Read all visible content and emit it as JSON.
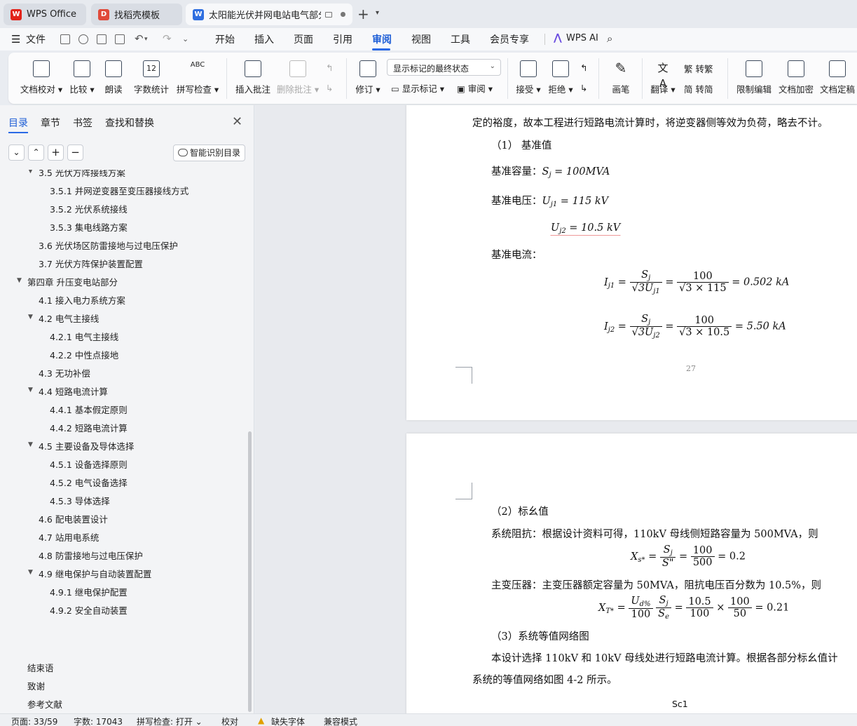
{
  "colors": {
    "accent": "#2b6ae6",
    "wps_red": "#e2231a",
    "docer_red": "#e04a3a",
    "writer_blue": "#2f6fe0"
  },
  "tabs": [
    {
      "label": "WPS Office",
      "icon": "wps-logo-icon"
    },
    {
      "label": "找稻壳模板",
      "icon": "docer-icon"
    },
    {
      "label": "太阳能光伏并网电站电气部分设",
      "icon": "writer-doc-icon"
    }
  ],
  "menu": {
    "file": "文件",
    "items": [
      "开始",
      "插入",
      "页面",
      "引用",
      "审阅",
      "视图",
      "工具",
      "会员专享"
    ],
    "active": "审阅",
    "ai": "WPS AI"
  },
  "ribbon": {
    "doc_check": "文档校对",
    "compare": "比较",
    "read_aloud": "朗读",
    "word_count": "字数统计",
    "spell_check": "拼写检查",
    "insert_comment": "插入批注",
    "delete_comment": "删除批注",
    "revise": "修订",
    "markup_select": "显示标记的最终状态",
    "show_markup": "显示标记",
    "review": "审阅",
    "accept": "接受",
    "reject": "拒绝",
    "pen": "画笔",
    "translate": "翻译",
    "to_traditional": "转繁",
    "to_simplified": "转简",
    "restrict_edit": "限制编辑",
    "encrypt": "文档加密",
    "finalize": "文档定稿"
  },
  "left_panel": {
    "tabs": [
      "目录",
      "章节",
      "书签",
      "查找和替换"
    ],
    "smart_btn": "智能识别目录",
    "toc": [
      {
        "label": "3.5  光伏方阵接线方案",
        "level": 2,
        "collapsible": true
      },
      {
        "label": "3.5.1  并网逆变器至变压器接线方式",
        "level": 3
      },
      {
        "label": "3.5.2  光伏系统接线",
        "level": 3
      },
      {
        "label": "3.5.3  集电线路方案",
        "level": 3
      },
      {
        "label": "3.6  光伏场区防雷接地与过电压保护",
        "level": 2
      },
      {
        "label": "3.7  光伏方阵保护装置配置",
        "level": 2
      },
      {
        "label": "第四章  升压变电站部分",
        "level": 1,
        "collapsible": true
      },
      {
        "label": "4.1  接入电力系统方案",
        "level": 2
      },
      {
        "label": "4.2  电气主接线",
        "level": 2,
        "collapsible": true
      },
      {
        "label": "4.2.1  电气主接线",
        "level": 3
      },
      {
        "label": "4.2.2  中性点接地",
        "level": 3
      },
      {
        "label": "4.3  无功补偿",
        "level": 2
      },
      {
        "label": "4.4  短路电流计算",
        "level": 2,
        "collapsible": true
      },
      {
        "label": "4.4.1 基本假定原则",
        "level": 3
      },
      {
        "label": "4.4.2  短路电流计算",
        "level": 3
      },
      {
        "label": "4.5  主要设备及导体选择",
        "level": 2,
        "collapsible": true
      },
      {
        "label": "4.5.1  设备选择原则",
        "level": 3
      },
      {
        "label": "4.5.2  电气设备选择",
        "level": 3
      },
      {
        "label": "4.5.3  导体选择",
        "level": 3
      },
      {
        "label": "4.6  配电装置设计",
        "level": 2
      },
      {
        "label": "4.7  站用电系统",
        "level": 2
      },
      {
        "label": "4.8  防雷接地与过电压保护",
        "level": 2
      },
      {
        "label": "4.9  继电保护与自动装置配置",
        "level": 2,
        "collapsible": true
      },
      {
        "label": "4.9.1  继电保护配置",
        "level": 3
      },
      {
        "label": "4.9.2  安全自动装置",
        "level": 3
      }
    ],
    "footer": [
      "结束语",
      "致谢",
      "参考文献"
    ]
  },
  "doc": {
    "p1_line0": "定的裕度，故本工程进行短路电流计算时，将逆变器侧等效为负荷，略去不计。",
    "p1_h1": "（1） 基准值",
    "p1_sj_label": "基准容量：",
    "p1_sj": "S",
    "p1_sj_sub": "j",
    "p1_sj_val": " = 100MVA",
    "p1_uj_label": "基准电压：",
    "p1_uj1": "U",
    "p1_uj1_sub": "j1",
    "p1_uj1_val": " = 115 kV",
    "p1_uj2": "U",
    "p1_uj2_sub": "j2",
    "p1_uj2_val": " = 10.5 kV",
    "p1_ij_label": "基准电流：",
    "eq1_lhs": "I",
    "eq1_lhs_sub": "j1",
    "eq1_f1_n": "S",
    "eq1_f1_n_sub": "j",
    "eq1_f1_d": "√3U",
    "eq1_f1_d_sub": "j1",
    "eq1_f2_n": "100",
    "eq1_f2_d": "√3 × 115",
    "eq1_res": "= 0.502 kA",
    "eq2_lhs": "I",
    "eq2_lhs_sub": "j2",
    "eq2_f1_n": "S",
    "eq2_f1_n_sub": "j",
    "eq2_f1_d": "√3U",
    "eq2_f1_d_sub": "j2",
    "eq2_f2_n": "100",
    "eq2_f2_d": "√3 × 10.5",
    "eq2_res": "= 5.50 kA",
    "page_num": "27",
    "p2_h2": "（2）标幺值",
    "p2_sys": "系统阻抗：根据设计资料可得，110kV 母线侧短路容量为 500MVA，则",
    "eq3_lhs": "X",
    "eq3_lhs_sub": "s*",
    "eq3_f1_n": "S",
    "eq3_f1_n_sub": "j",
    "eq3_f1_d": "S\"",
    "eq3_f2_n": "100",
    "eq3_f2_d": "500",
    "eq3_res": "= 0.2",
    "p2_tr": "主变压器：主变压器额定容量为 50MVA，阻抗电压百分数为 10.5%，则",
    "eq4_lhs": "X",
    "eq4_lhs_sub": "T*",
    "eq4_f1_n": "U",
    "eq4_f1_n_sub": "d%",
    "eq4_f1_d": "100",
    "eq4_f2_n": "S",
    "eq4_f2_n_sub": "j",
    "eq4_f2_d": "S",
    "eq4_f2_d_sub": "e",
    "eq4_f3_n": "10.5",
    "eq4_f3_d": "100",
    "eq4_f4_n": "100",
    "eq4_f4_d": "50",
    "eq4_res": "= 0.21",
    "p2_h3": "（3）系统等值网络图",
    "p2_para1": "本设计选择 110kV 和 10kV 母线处进行短路电流计算。根据各部分标幺值计",
    "p2_para2": "系统的等值网络如图 4-2 所示。",
    "p2_fig_label": "Sc1"
  },
  "status": {
    "page": "页面: 33/59",
    "words": "字数: 17043",
    "spell": "拼写检查: 打开",
    "proof": "校对",
    "missing_font": "缺失字体",
    "compat": "兼容模式"
  }
}
